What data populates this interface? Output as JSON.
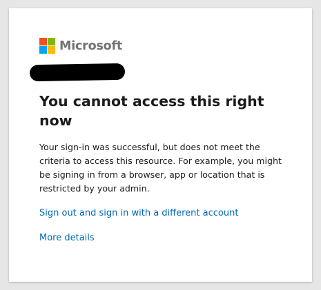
{
  "logo": {
    "name": "Microsoft",
    "colors": [
      "#f25022",
      "#7fba00",
      "#00a4ef",
      "#ffb900"
    ]
  },
  "account": {
    "redacted": true
  },
  "main": {
    "title": "You cannot access this right now",
    "description": "Your sign-in was successful, but does not meet the criteria to access this resource. For example, you might be signing in from a browser, app or location that is restricted by your admin.",
    "signout_link": "Sign out and sign in with a different account",
    "more_details_link": "More details"
  },
  "colors": {
    "link": "#0067b8",
    "text": "#1b1b1b",
    "background": "#e6e6e6",
    "card": "#ffffff"
  }
}
